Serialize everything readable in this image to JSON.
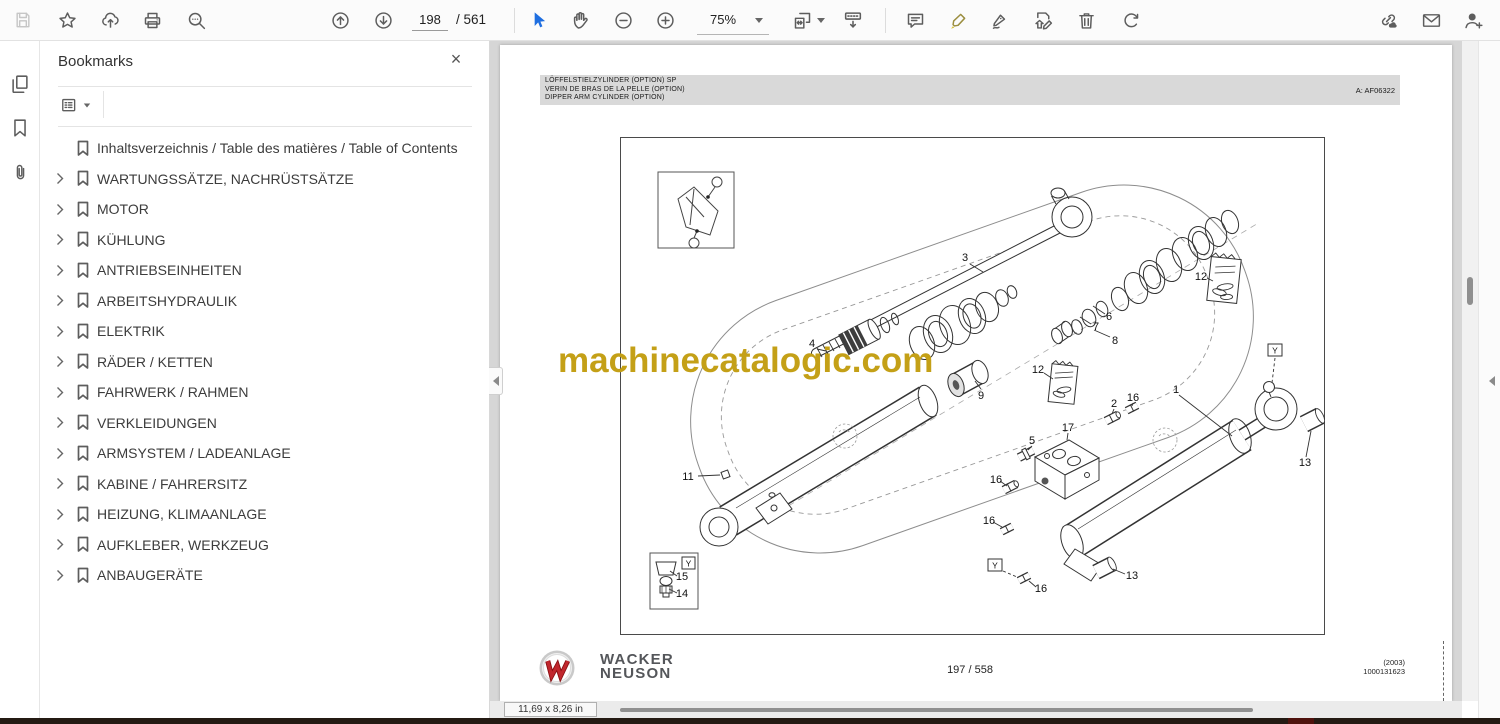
{
  "colors": {
    "accent": "#1e6ee0",
    "watermark_gold": "#c4a017",
    "logo_red": "#c1272d",
    "brand_gray": "#54565a"
  },
  "toolbar": {
    "left_icons": [
      "save-icon",
      "star-icon",
      "share-cloud-icon",
      "print-icon",
      "search-icon"
    ],
    "nav_icons": [
      "page-up-icon",
      "page-down-icon"
    ],
    "page_current": "198",
    "page_total": "/ 561",
    "tool_icons": [
      "select-icon",
      "hand-icon",
      "zoom-out-icon",
      "zoom-in-icon"
    ],
    "zoom_value": "75%",
    "view_icons": [
      "fit-options-icon",
      "page-display-icon"
    ],
    "annotate_icons": [
      "comment-icon",
      "highlight-icon",
      "sign-icon",
      "edit-page-icon",
      "delete-icon",
      "rotate-icon"
    ],
    "right_icons": [
      "share-link-icon",
      "email-icon",
      "add-user-icon"
    ]
  },
  "nav_rail": {
    "icons": [
      "page-thumbnails-icon",
      "bookmarks-icon",
      "attachments-icon"
    ],
    "active": "bookmarks-icon"
  },
  "bookmarks_panel": {
    "title": "Bookmarks",
    "items": [
      {
        "label": "Inhaltsverzeichnis / Table des matières / Table of Contents",
        "expandable": false
      },
      {
        "label": "WARTUNGSSÄTZE, NACHRÜSTSÄTZE",
        "expandable": true
      },
      {
        "label": "MOTOR",
        "expandable": true
      },
      {
        "label": "KÜHLUNG",
        "expandable": true
      },
      {
        "label": "ANTRIEBSEINHEITEN",
        "expandable": true
      },
      {
        "label": "ARBEITSHYDRAULIK",
        "expandable": true
      },
      {
        "label": "ELEKTRIK",
        "expandable": true
      },
      {
        "label": "RÄDER / KETTEN",
        "expandable": true
      },
      {
        "label": "FAHRWERK / RAHMEN",
        "expandable": true
      },
      {
        "label": "VERKLEIDUNGEN",
        "expandable": true
      },
      {
        "label": "ARMSYSTEM / LADEANLAGE",
        "expandable": true
      },
      {
        "label": "KABINE / FAHRERSITZ",
        "expandable": true
      },
      {
        "label": "HEIZUNG, KLIMAANLAGE",
        "expandable": true
      },
      {
        "label": "AUFKLEBER, WERKZEUG",
        "expandable": true
      },
      {
        "label": "ANBAUGERÄTE",
        "expandable": true
      }
    ]
  },
  "page": {
    "header": {
      "title_de": "LÖFFELSTIELZYLINDER (OPTION) SP",
      "title_fr": "VERIN DE BRAS DE LA PELLE (OPTION)",
      "title_en": "DIPPER ARM CYLINDER (OPTION)",
      "ref": "A: AF06322"
    },
    "watermark": "machinecatalogic.com",
    "callouts": [
      "3",
      "4",
      "12",
      "6",
      "7",
      "8",
      "12",
      "9",
      "11",
      "1",
      "2",
      "16",
      "17",
      "5",
      "16",
      "16",
      "16",
      "13",
      "13",
      "15",
      "14",
      "Y",
      "Y",
      "Y"
    ],
    "footer": {
      "brand_top": "WACKER",
      "brand_bottom": "NEUSON",
      "page_info": "197 / 558",
      "year": "(2003)",
      "doc_number": "1000131623"
    }
  },
  "status_bar": {
    "page_size": "11,69 x 8,26 in"
  }
}
